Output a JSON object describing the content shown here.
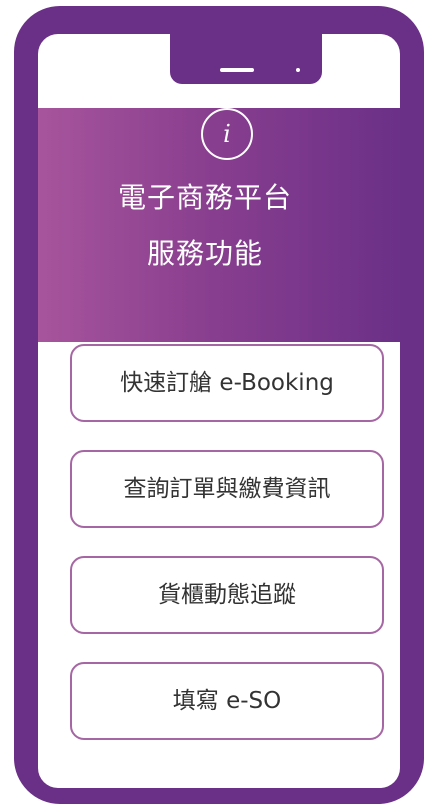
{
  "header": {
    "icon": "info-icon",
    "icon_glyph": "i",
    "title_line1": "電子商務平台",
    "title_line2": "服務功能"
  },
  "menu": {
    "items": [
      {
        "label": "快速訂艙 e-Booking"
      },
      {
        "label": "查詢訂單與繳費資訊"
      },
      {
        "label": "貨櫃動態追蹤"
      },
      {
        "label": "填寫 e-SO"
      }
    ]
  },
  "colors": {
    "phone_frame": "#6a2f86",
    "header_gradient_start": "#a7559c",
    "header_gradient_end": "#6b3088",
    "button_border": "#a566a3",
    "button_text": "#333333"
  }
}
